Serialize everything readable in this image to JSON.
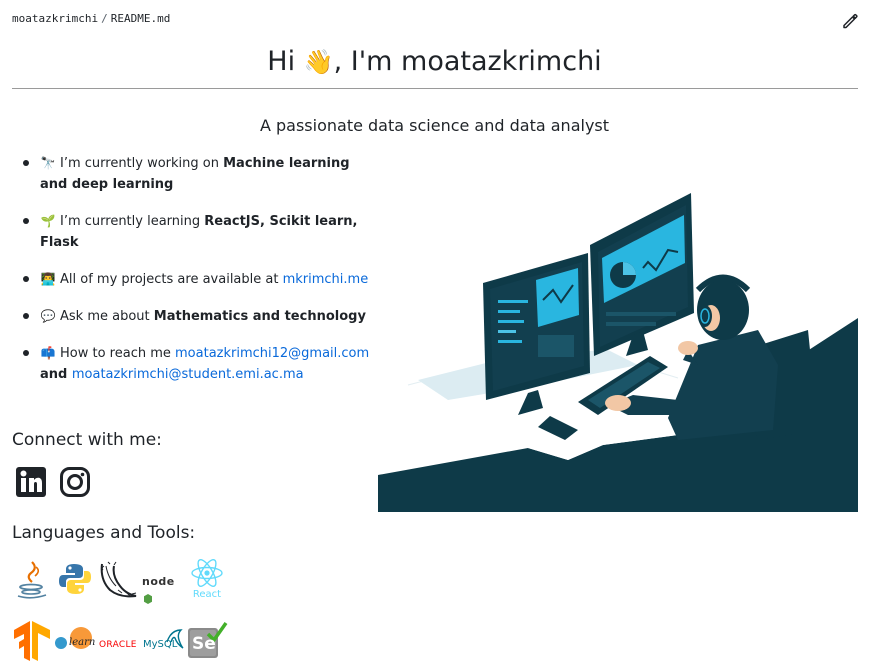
{
  "breadcrumb": {
    "user": "moatazkrimchi",
    "separator": "/",
    "file": "README.md"
  },
  "heading": {
    "pre": "Hi ",
    "wave": "👋",
    "post": ", I'm moatazkrimchi"
  },
  "subtitle": "A passionate data science and data analyst",
  "bullets": {
    "b1": {
      "emoji": "🔭",
      "text": "I’m currently working on ",
      "strong": "Machine learning and deep learning"
    },
    "b2": {
      "emoji": "🌱",
      "text": "I’m currently learning ",
      "strong": "ReactJS, Scikit learn, Flask"
    },
    "b3": {
      "emoji": "👨‍💻",
      "text": "All of my projects are available at ",
      "link": "mkrimchi.me"
    },
    "b4": {
      "emoji": "💬",
      "text": "Ask me about ",
      "strong": "Mathematics and technology"
    },
    "b5": {
      "emoji": "📫",
      "text": "How to reach me ",
      "link1": "moatazkrimchi12@gmail.com",
      "and": " and ",
      "link2": "moatazkrimchi@student.emi.ac.ma"
    }
  },
  "connect_heading": "Connect with me:",
  "tools_heading": "Languages and Tools:",
  "tools": {
    "react": "React",
    "node": "node",
    "scikit": "learn",
    "oracle": "ORACLE",
    "mysql": "MySQL",
    "selenium": "Se"
  },
  "icons": {
    "edit": "pencil-icon",
    "linkedin": "linkedin-icon",
    "instagram": "instagram-icon"
  },
  "colors": {
    "link": "#0969da",
    "hero_dark": "#0e3a48",
    "hero_accent": "#29b6e0"
  }
}
